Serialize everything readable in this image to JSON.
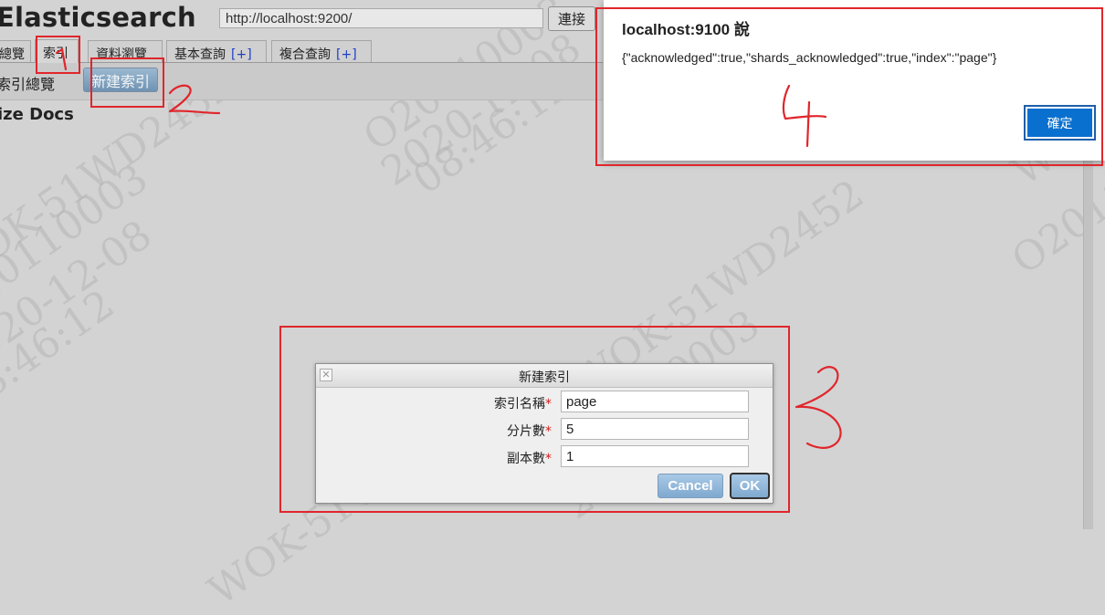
{
  "header": {
    "app_title": "Elasticsearch",
    "url_value": "http://localhost:9200/",
    "connect_label": "連接"
  },
  "tabs": [
    {
      "label": "總覽",
      "plus": ""
    },
    {
      "label": "索引",
      "plus": ""
    },
    {
      "label": "資料瀏覽",
      "plus": ""
    },
    {
      "label": "基本查詢",
      "plus": "[+]"
    },
    {
      "label": "複合查詢",
      "plus": "[+]"
    }
  ],
  "toolbar": {
    "title": "索引總覽",
    "new_index_label": "新建索引"
  },
  "table": {
    "header": "ize Docs"
  },
  "alert": {
    "title": "localhost:9100 說",
    "message": "{\"acknowledged\":true,\"shards_acknowledged\":true,\"index\":\"page\"}",
    "ok_label": "確定"
  },
  "dialog": {
    "title": "新建索引",
    "fields": [
      {
        "label": "索引名稱",
        "value": "page"
      },
      {
        "label": "分片數",
        "value": "5"
      },
      {
        "label": "副本數",
        "value": "1"
      }
    ],
    "required_mark": "*",
    "cancel_label": "Cancel",
    "ok_label": "OK"
  },
  "annotations": {
    "color": "#e0262b",
    "numbers": [
      "1",
      "2",
      "3",
      "4"
    ]
  },
  "watermark": {
    "lines": [
      "WOK-51WD2452",
      "O20110003",
      "2020-12-08",
      "08:46:12"
    ]
  }
}
